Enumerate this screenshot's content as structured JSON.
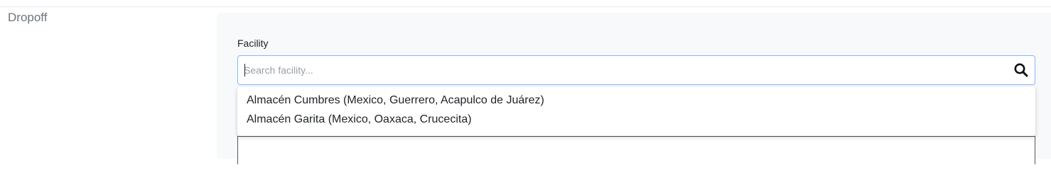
{
  "section": {
    "label": "Dropoff"
  },
  "facility": {
    "label": "Facility",
    "search": {
      "value": "",
      "placeholder": "Search facility..."
    },
    "search_icon": "search-icon",
    "options": [
      {
        "label": "Almacén Cumbres (Mexico, Guerrero, Acapulco de Juárez)"
      },
      {
        "label": "Almacén Garita (Mexico, Oaxaca, Crucecita)"
      }
    ]
  },
  "colors": {
    "focus_border": "#86b7fe",
    "panel_bg": "#f8f9fa",
    "muted_text": "#6c757d"
  }
}
